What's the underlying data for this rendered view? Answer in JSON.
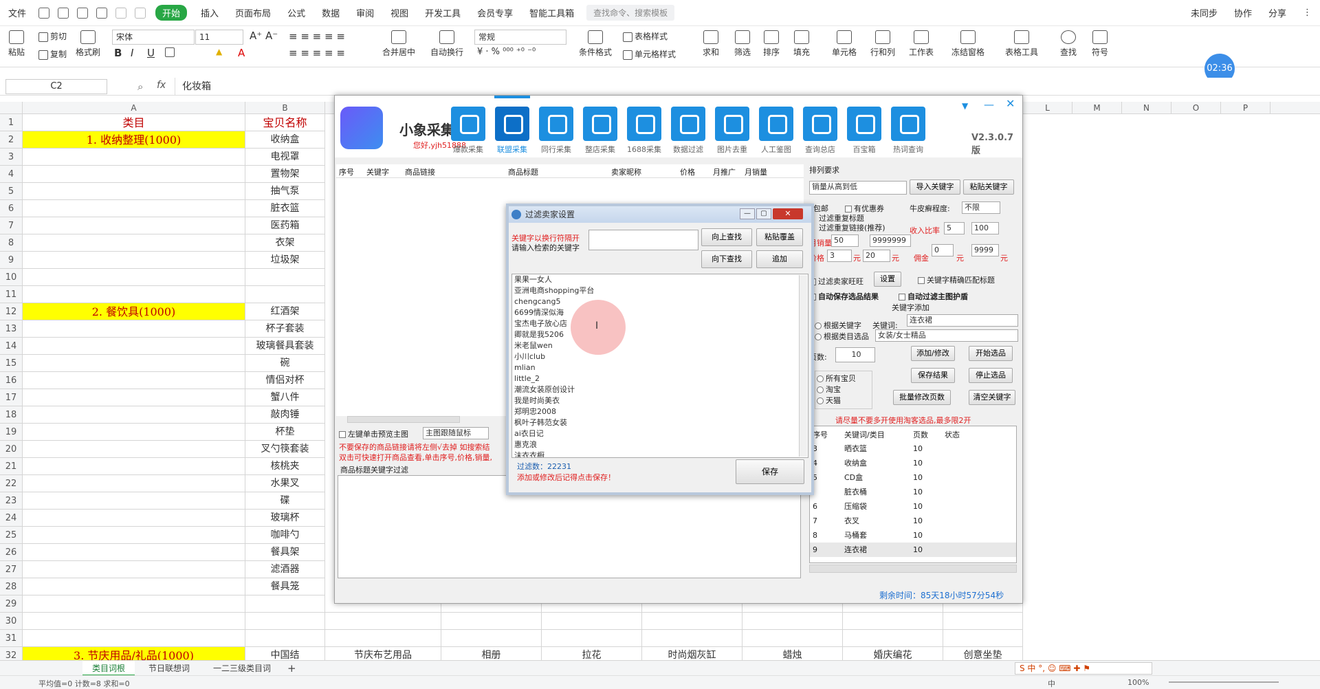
{
  "menubar": {
    "file": "文件",
    "tabs": [
      "开始",
      "插入",
      "页面布局",
      "公式",
      "数据",
      "审阅",
      "视图",
      "开发工具",
      "会员专享",
      "智能工具箱"
    ],
    "search_placeholder": "查找命令、搜索模板",
    "right": [
      "未同步",
      "协作",
      "分享"
    ]
  },
  "ribbon": {
    "paste": "粘贴",
    "cut": "剪切",
    "copy": "复制",
    "format_painter": "格式刷",
    "font": "宋体",
    "font_size": "11",
    "merge": "合并居中",
    "wrap": "自动换行",
    "number_format": "常规",
    "cond_format": "条件格式",
    "table_style": "表格样式",
    "cell_style": "单元格样式",
    "sum": "求和",
    "filter": "筛选",
    "sort": "排序",
    "fill": "填充",
    "cell": "单元格",
    "rowcol": "行和列",
    "sheet": "工作表",
    "freeze": "冻结窗格",
    "tools": "表格工具",
    "find": "查找",
    "symbol": "符号",
    "timer": "02:36"
  },
  "formula": {
    "cell_ref": "C2",
    "fx": "fx",
    "value": "化妆箱"
  },
  "columns": [
    "A",
    "B",
    "L",
    "M",
    "N",
    "O",
    "P"
  ],
  "row_numbers": [
    "1",
    "2",
    "3",
    "4",
    "5",
    "6",
    "7",
    "8",
    "9",
    "10",
    "11",
    "12",
    "13",
    "14",
    "15",
    "16",
    "17",
    "18",
    "19",
    "20",
    "21",
    "22",
    "23",
    "24",
    "25",
    "26",
    "27",
    "28",
    "29",
    "30",
    "31",
    "32"
  ],
  "sheet": {
    "header_a": "类目",
    "header_b": "宝贝名称",
    "cat1": "1. 收纳整理(1000)",
    "cat2": "2. 餐饮具(1000)",
    "cat3": "3. 节庆用品/礼品(1000)",
    "items1": [
      "收纳盒",
      "电视罩",
      "置物架",
      "抽气泵",
      "脏衣篮",
      "医药箱",
      "衣架",
      "垃圾架"
    ],
    "items2": [
      "红酒架",
      "杯子套装",
      "玻璃餐具套装",
      "碗",
      "情侣对杯",
      "蟹八件",
      "敲肉锤",
      "杯垫",
      "叉勺筷套装",
      "核桃夹",
      "水果叉",
      "碟",
      "玻璃杯",
      "咖啡勺",
      "餐具架",
      "滤酒器",
      "餐具笼"
    ],
    "row32": [
      "中国结",
      "节庆布艺用品",
      "相册",
      "拉花",
      "时尚烟灰缸",
      "蜡烛",
      "婚庆编花",
      "创意坐垫"
    ]
  },
  "sheet_tabs": [
    "类目词根",
    "节日联想词",
    "一二三级类目词"
  ],
  "status": {
    "left": "平均值=0  计数=8  求和=0",
    "zoom": "100%",
    "ime": "中"
  },
  "app": {
    "title": "小象采集",
    "greeting": "您好,yjh51888",
    "version": "V2.3.0.7版",
    "toolbar": [
      "爆款采集",
      "联盟采集",
      "同行采集",
      "整店采集",
      "1688采集",
      "数据过滤",
      "图片去重",
      "人工鉴图",
      "查询总店",
      "百宝箱",
      "热词查询"
    ],
    "grid_headers": [
      "序号",
      "关键字",
      "商品链接",
      "商品标题",
      "卖家昵称",
      "价格",
      "月推广",
      "月销量"
    ],
    "sort_label": "排列要求",
    "sort_value": "销量从高到低",
    "import_kw": "导入关键字",
    "paste_kw": "粘贴关键字",
    "free_ship": "包邮",
    "has_coupon": "有优惠券",
    "psoriasis": "牛皮癣程度:",
    "psoriasis_value": "不限",
    "filter_dup_title": "过滤重复标题",
    "filter_dup_link": "过滤重复链接(推荐)",
    "income_ratio": "收入比率",
    "income_min": "5",
    "income_max": "100",
    "monthly_sales": "月销量",
    "sales_min": "50",
    "sales_max": "9999999",
    "price": "价格",
    "price_min": "3",
    "price_max": "20",
    "yuan": "元",
    "commission": "佣金",
    "comm_min": "0",
    "comm_max": "9999",
    "filter_seller": "过滤卖家旺旺",
    "setting": "设置",
    "exact_match": "关键字精确匹配标题",
    "auto_save": "自动保存选品结果",
    "auto_filter_img": "自动过滤主图护盾",
    "kw_add_label": "关键字添加",
    "by_keyword": "根据关键字",
    "by_category": "根据类目选品",
    "keyword_label": "关键词:",
    "keyword_value": "连衣裙",
    "category_value": "女装/女士精品",
    "pages_label": "页数:",
    "pages_value": "10",
    "add_modify": "添加/修改",
    "start": "开始选品",
    "save_result": "保存结果",
    "stop": "停止选品",
    "batch_pages": "批量修改页数",
    "clear_kw": "清空关键字",
    "all_items": "所有宝贝",
    "taobao": "淘宝",
    "tmall": "天猫",
    "warn": "请尽量不要多开使用淘客选品,最多限2开",
    "kw_headers": [
      "序号",
      "关键词/类目",
      "页数",
      "状态"
    ],
    "kw_rows": [
      [
        "3",
        "晒衣篮",
        "10"
      ],
      [
        "4",
        "收纳盒",
        "10"
      ],
      [
        "5",
        "CD盒",
        "10"
      ],
      [
        "",
        "脏衣桶",
        "10"
      ],
      [
        "6",
        "压缩袋",
        "10"
      ],
      [
        "7",
        "衣叉",
        "10"
      ],
      [
        "8",
        "马桶套",
        "10"
      ],
      [
        "9",
        "连衣裙",
        "10"
      ]
    ],
    "remaining": "剩余时间：85天18小时57分54秒",
    "preview_check": "左键单击预览主图",
    "follow_mouse": "主图跟随鼠标",
    "note1": "不要保存的商品链接请将左侧√去掉  如搜索结",
    "note2": "双击可快速打开商品查看,单击序号,价格,销量,",
    "title_filter": "商品标题关键字过滤"
  },
  "dialog": {
    "title": "过滤卖家设置",
    "hint1": "关键字以换行符隔开",
    "hint2": "请输入检索的关键字",
    "find_up": "向上查找",
    "paste_cover": "粘贴覆盖",
    "find_down": "向下查找",
    "append": "追加",
    "list": [
      "果果一女人",
      "亚洲电商shopping平台",
      "chengcang5",
      "6699情深似海",
      "宝杰电子放心店",
      "卿就是我5206",
      "米老鼠wen",
      "小川club",
      "mlian",
      "little_2",
      "潮流女装原创设计",
      "我是时尚美衣",
      "郑明忠2008",
      "枫叶子韩范女装",
      "ai衣日记",
      "惠克浪",
      "沫衣衣橱"
    ],
    "count": "过滤数：22231",
    "tip": "添加或修改后记得点击保存！",
    "save": "保存"
  },
  "colors": {
    "accent": "#28a745",
    "yellow": "#ffff00",
    "red": "#c00000",
    "blue": "#1d8fe0"
  }
}
